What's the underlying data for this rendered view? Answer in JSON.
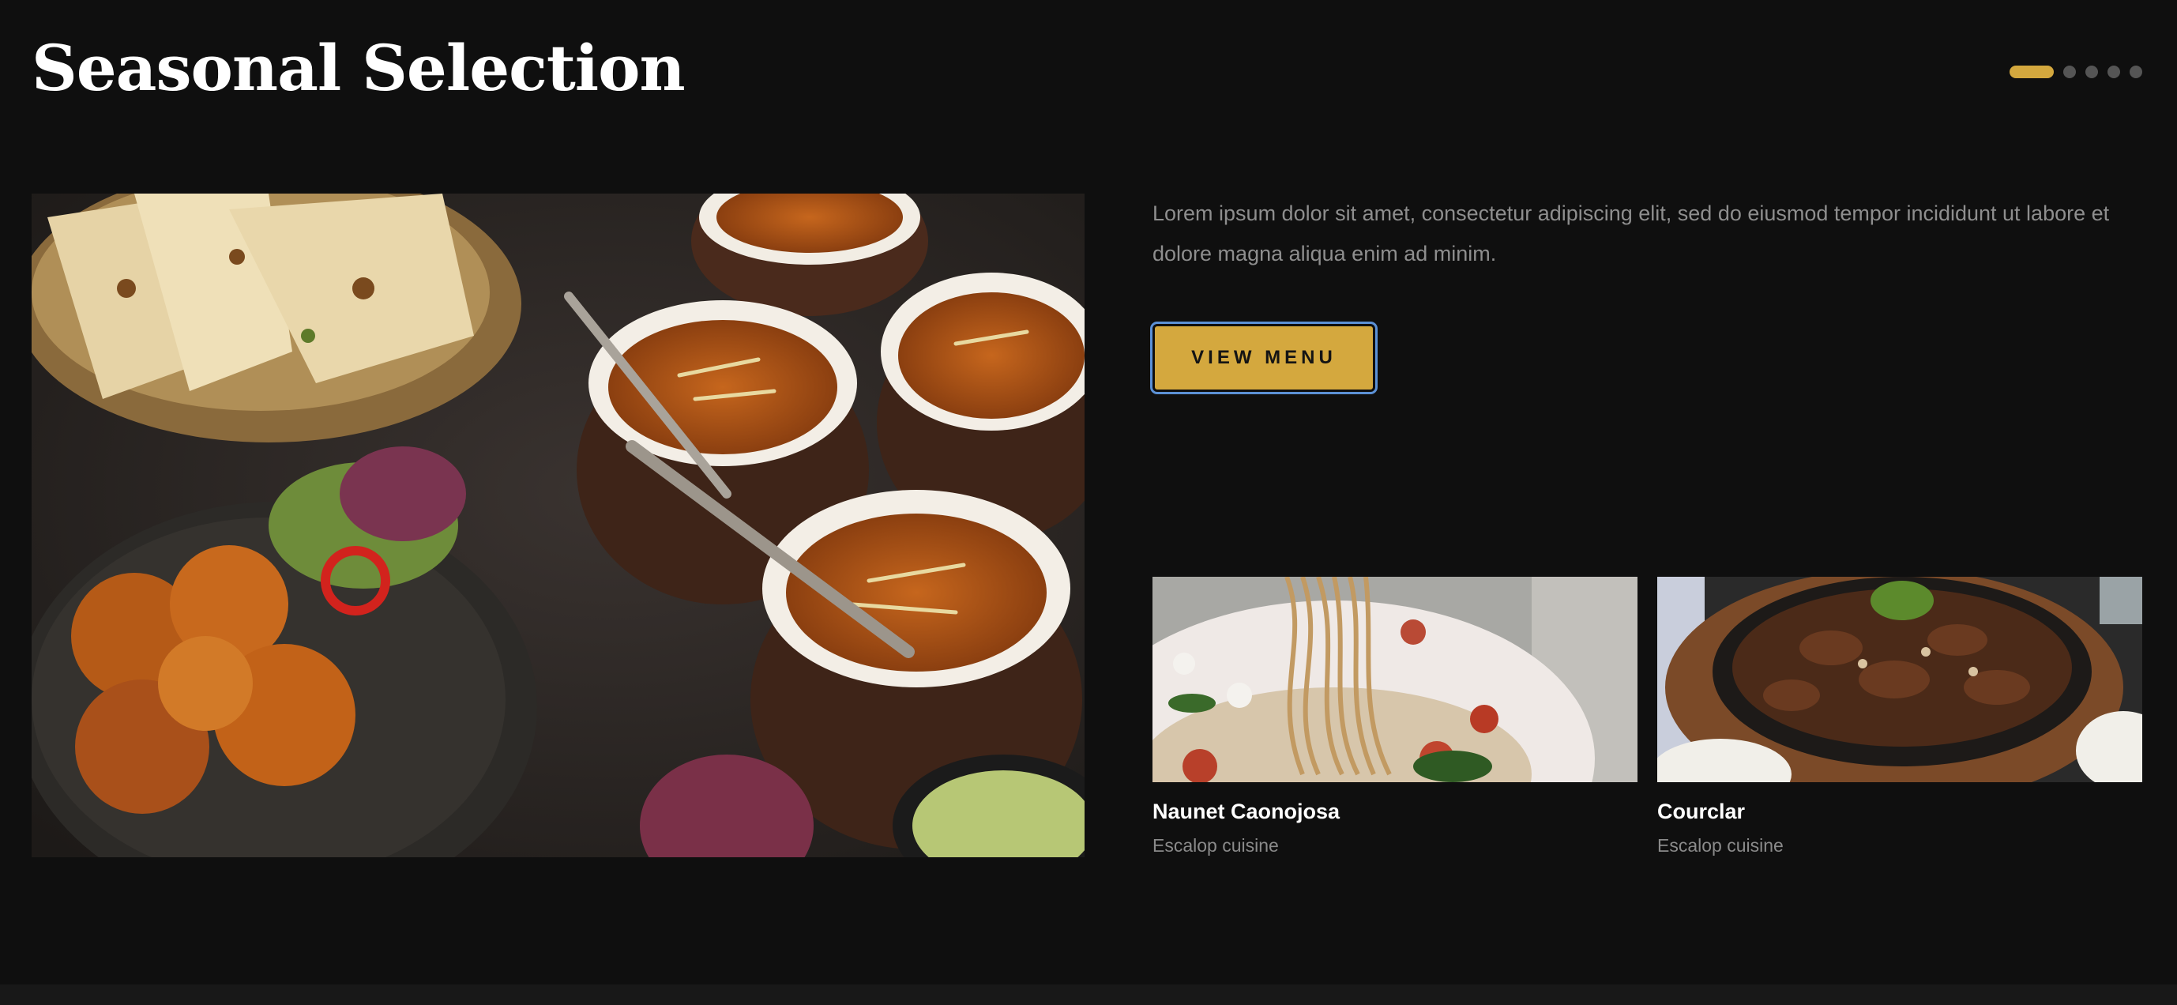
{
  "section": {
    "title": "Seasonal Selection",
    "description": "Lorem ipsum dolor sit amet, consectetur adipiscing elit, sed do eiusmod tempor incididunt ut labore et dolore magna aliqua enim ad minim.",
    "cta_label": "VIEW MENU"
  },
  "pager": {
    "total": 5,
    "active_index": 0,
    "active_color": "#d4a83e",
    "inactive_color": "#555555"
  },
  "hero_image": {
    "icon": "indian-food-spread-image"
  },
  "cards": [
    {
      "title": "Naunet Caonojosa",
      "subtitle": "Escalop cuisine",
      "image": "spaghetti-image"
    },
    {
      "title": "Courclar",
      "subtitle": "Escalop cuisine",
      "image": "sizzling-beef-image"
    }
  ],
  "colors": {
    "background": "#0f0f0f",
    "accent": "#d4a83e",
    "muted_text": "#8e8e8e"
  }
}
